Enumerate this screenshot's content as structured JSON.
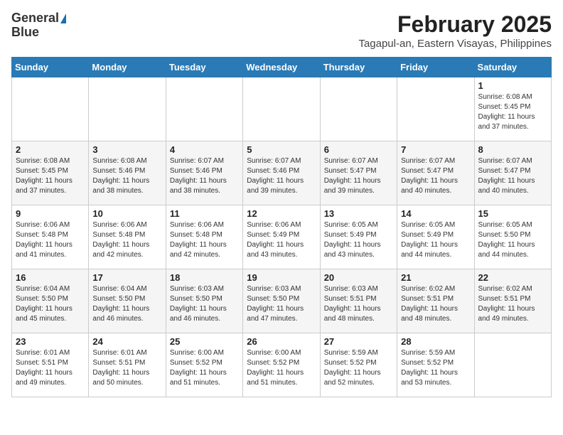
{
  "header": {
    "logo_line1": "General",
    "logo_line2": "Blue",
    "title": "February 2025",
    "subtitle": "Tagapul-an, Eastern Visayas, Philippines"
  },
  "calendar": {
    "days_of_week": [
      "Sunday",
      "Monday",
      "Tuesday",
      "Wednesday",
      "Thursday",
      "Friday",
      "Saturday"
    ],
    "weeks": [
      [
        {
          "day": "",
          "info": ""
        },
        {
          "day": "",
          "info": ""
        },
        {
          "day": "",
          "info": ""
        },
        {
          "day": "",
          "info": ""
        },
        {
          "day": "",
          "info": ""
        },
        {
          "day": "",
          "info": ""
        },
        {
          "day": "1",
          "info": "Sunrise: 6:08 AM\nSunset: 5:45 PM\nDaylight: 11 hours\nand 37 minutes."
        }
      ],
      [
        {
          "day": "2",
          "info": "Sunrise: 6:08 AM\nSunset: 5:45 PM\nDaylight: 11 hours\nand 37 minutes."
        },
        {
          "day": "3",
          "info": "Sunrise: 6:08 AM\nSunset: 5:46 PM\nDaylight: 11 hours\nand 38 minutes."
        },
        {
          "day": "4",
          "info": "Sunrise: 6:07 AM\nSunset: 5:46 PM\nDaylight: 11 hours\nand 38 minutes."
        },
        {
          "day": "5",
          "info": "Sunrise: 6:07 AM\nSunset: 5:46 PM\nDaylight: 11 hours\nand 39 minutes."
        },
        {
          "day": "6",
          "info": "Sunrise: 6:07 AM\nSunset: 5:47 PM\nDaylight: 11 hours\nand 39 minutes."
        },
        {
          "day": "7",
          "info": "Sunrise: 6:07 AM\nSunset: 5:47 PM\nDaylight: 11 hours\nand 40 minutes."
        },
        {
          "day": "8",
          "info": "Sunrise: 6:07 AM\nSunset: 5:47 PM\nDaylight: 11 hours\nand 40 minutes."
        }
      ],
      [
        {
          "day": "9",
          "info": "Sunrise: 6:06 AM\nSunset: 5:48 PM\nDaylight: 11 hours\nand 41 minutes."
        },
        {
          "day": "10",
          "info": "Sunrise: 6:06 AM\nSunset: 5:48 PM\nDaylight: 11 hours\nand 42 minutes."
        },
        {
          "day": "11",
          "info": "Sunrise: 6:06 AM\nSunset: 5:48 PM\nDaylight: 11 hours\nand 42 minutes."
        },
        {
          "day": "12",
          "info": "Sunrise: 6:06 AM\nSunset: 5:49 PM\nDaylight: 11 hours\nand 43 minutes."
        },
        {
          "day": "13",
          "info": "Sunrise: 6:05 AM\nSunset: 5:49 PM\nDaylight: 11 hours\nand 43 minutes."
        },
        {
          "day": "14",
          "info": "Sunrise: 6:05 AM\nSunset: 5:49 PM\nDaylight: 11 hours\nand 44 minutes."
        },
        {
          "day": "15",
          "info": "Sunrise: 6:05 AM\nSunset: 5:50 PM\nDaylight: 11 hours\nand 44 minutes."
        }
      ],
      [
        {
          "day": "16",
          "info": "Sunrise: 6:04 AM\nSunset: 5:50 PM\nDaylight: 11 hours\nand 45 minutes."
        },
        {
          "day": "17",
          "info": "Sunrise: 6:04 AM\nSunset: 5:50 PM\nDaylight: 11 hours\nand 46 minutes."
        },
        {
          "day": "18",
          "info": "Sunrise: 6:03 AM\nSunset: 5:50 PM\nDaylight: 11 hours\nand 46 minutes."
        },
        {
          "day": "19",
          "info": "Sunrise: 6:03 AM\nSunset: 5:50 PM\nDaylight: 11 hours\nand 47 minutes."
        },
        {
          "day": "20",
          "info": "Sunrise: 6:03 AM\nSunset: 5:51 PM\nDaylight: 11 hours\nand 48 minutes."
        },
        {
          "day": "21",
          "info": "Sunrise: 6:02 AM\nSunset: 5:51 PM\nDaylight: 11 hours\nand 48 minutes."
        },
        {
          "day": "22",
          "info": "Sunrise: 6:02 AM\nSunset: 5:51 PM\nDaylight: 11 hours\nand 49 minutes."
        }
      ],
      [
        {
          "day": "23",
          "info": "Sunrise: 6:01 AM\nSunset: 5:51 PM\nDaylight: 11 hours\nand 49 minutes."
        },
        {
          "day": "24",
          "info": "Sunrise: 6:01 AM\nSunset: 5:51 PM\nDaylight: 11 hours\nand 50 minutes."
        },
        {
          "day": "25",
          "info": "Sunrise: 6:00 AM\nSunset: 5:52 PM\nDaylight: 11 hours\nand 51 minutes."
        },
        {
          "day": "26",
          "info": "Sunrise: 6:00 AM\nSunset: 5:52 PM\nDaylight: 11 hours\nand 51 minutes."
        },
        {
          "day": "27",
          "info": "Sunrise: 5:59 AM\nSunset: 5:52 PM\nDaylight: 11 hours\nand 52 minutes."
        },
        {
          "day": "28",
          "info": "Sunrise: 5:59 AM\nSunset: 5:52 PM\nDaylight: 11 hours\nand 53 minutes."
        },
        {
          "day": "",
          "info": ""
        }
      ]
    ]
  }
}
